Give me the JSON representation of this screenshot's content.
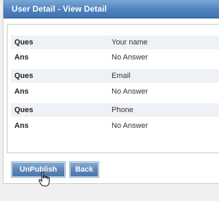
{
  "panel": {
    "title": "User Detail - View Detail"
  },
  "details": [
    {
      "key": "Ques",
      "value": "Your name"
    },
    {
      "key": "Ans",
      "value": "No Answer"
    },
    {
      "key": "Ques",
      "value": "Email"
    },
    {
      "key": "Ans",
      "value": "No Answer"
    },
    {
      "key": "Ques",
      "value": "Phone"
    },
    {
      "key": "Ans",
      "value": "No Answer"
    }
  ],
  "buttons": {
    "unpublish": "UnPublish",
    "back": "Back"
  },
  "icons": {
    "cursor": "hand-pointer-icon"
  },
  "colors": {
    "title_bar": "#4f82bd",
    "button": "#5c87b8",
    "row_shade": "#eef2f6"
  }
}
